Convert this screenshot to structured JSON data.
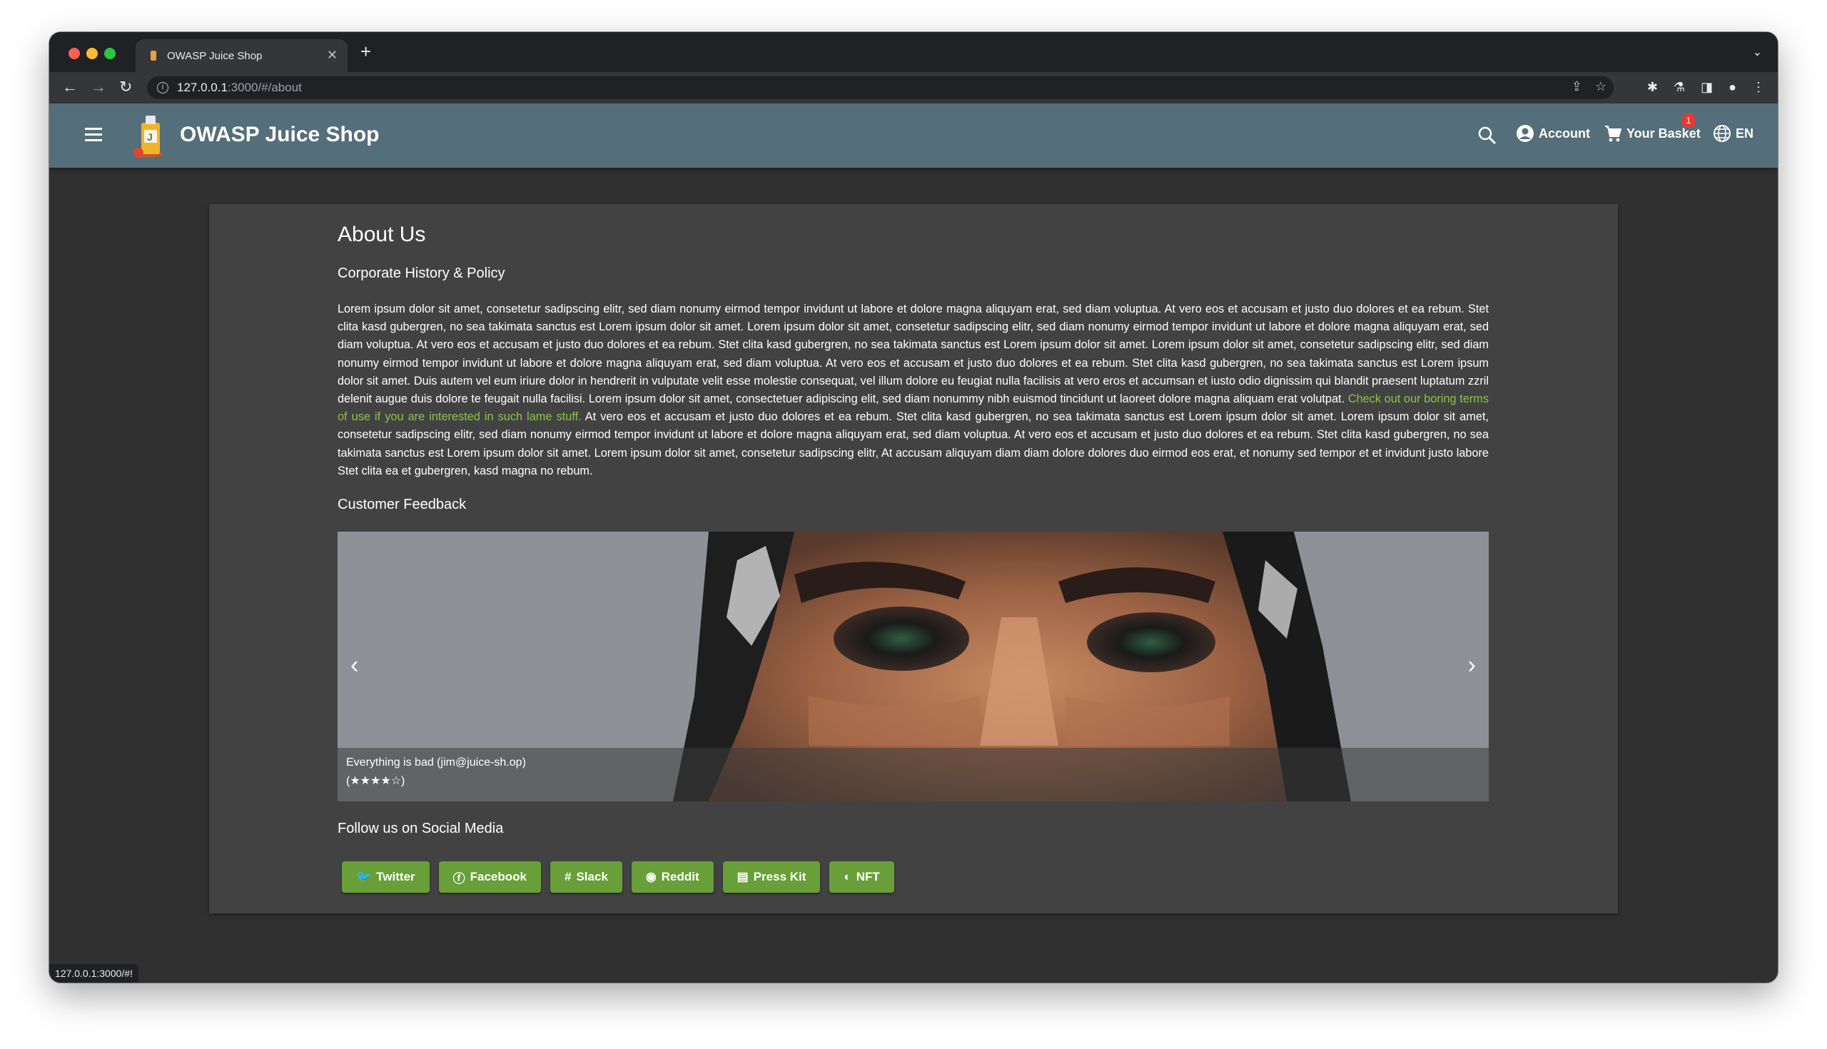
{
  "browser": {
    "tab_title": "OWASP Juice Shop",
    "url_host": "127.0.0.1",
    "url_path": ":3000/#/about",
    "status_url": "127.0.0.1:3000/#!"
  },
  "header": {
    "title": "OWASP Juice Shop",
    "account_label": "Account",
    "basket_label": "Your Basket",
    "basket_count": "1",
    "language_label": "EN"
  },
  "about": {
    "title": "About Us",
    "history_heading": "Corporate History & Policy",
    "paragraph_start": "Lorem ipsum dolor sit amet, consetetur sadipscing elitr, sed diam nonumy eirmod tempor invidunt ut labore et dolore magna aliquyam erat, sed diam voluptua. At vero eos et accusam et justo duo dolores et ea rebum. Stet clita kasd gubergren, no sea takimata sanctus est Lorem ipsum dolor sit amet. Lorem ipsum dolor sit amet, consetetur sadipscing elitr, sed diam nonumy eirmod tempor invidunt ut labore et dolore magna aliquyam erat, sed diam voluptua. At vero eos et accusam et justo duo dolores et ea rebum. Stet clita kasd gubergren, no sea takimata sanctus est Lorem ipsum dolor sit amet. Lorem ipsum dolor sit amet, consetetur sadipscing elitr, sed diam nonumy eirmod tempor invidunt ut labore et dolore magna aliquyam erat, sed diam voluptua. At vero eos et accusam et justo duo dolores et ea rebum. Stet clita kasd gubergren, no sea takimata sanctus est Lorem ipsum dolor sit amet. Duis autem vel eum iriure dolor in hendrerit in vulputate velit esse molestie consequat, vel illum dolore eu feugiat nulla facilisis at vero eros et accumsan et iusto odio dignissim qui blandit praesent luptatum zzril delenit augue duis dolore te feugait nulla facilisi. Lorem ipsum dolor sit amet, consectetuer adipiscing elit, sed diam nonummy nibh euismod tincidunt ut laoreet dolore magna aliquam erat volutpat. ",
    "terms_link": "Check out our boring terms of use if you are interested in such lame stuff.",
    "paragraph_end": " At vero eos et accusam et justo duo dolores et ea rebum. Stet clita kasd gubergren, no sea takimata sanctus est Lorem ipsum dolor sit amet. Lorem ipsum dolor sit amet, consetetur sadipscing elitr, sed diam nonumy eirmod tempor invidunt ut labore et dolore magna aliquyam erat, sed diam voluptua. At vero eos et accusam et justo duo dolores et ea rebum. Stet clita kasd gubergren, no sea takimata sanctus est Lorem ipsum dolor sit amet. Lorem ipsum dolor sit amet, consetetur sadipscing elitr, At accusam aliquyam diam diam dolore dolores duo eirmod eos erat, et nonumy sed tempor et et invidunt justo labore Stet clita ea et gubergren, kasd magna no rebum.",
    "feedback_heading": "Customer Feedback",
    "feedback_caption": "Everything is bad (jim@juice-sh.op)",
    "feedback_stars": "(★★★★☆)",
    "social_heading": "Follow us on Social Media"
  },
  "social_buttons": [
    {
      "label": "Twitter",
      "icon": "twitter-icon"
    },
    {
      "label": "Facebook",
      "icon": "facebook-icon"
    },
    {
      "label": "Slack",
      "icon": "slack-icon"
    },
    {
      "label": "Reddit",
      "icon": "reddit-icon"
    },
    {
      "label": "Press Kit",
      "icon": "newspaper-icon"
    },
    {
      "label": "NFT",
      "icon": "palette-icon"
    }
  ],
  "colors": {
    "app_bar": "#546e7a",
    "background": "#303030",
    "card": "#424242",
    "accent_green": "#689f38",
    "link_green": "#8bc34a"
  }
}
